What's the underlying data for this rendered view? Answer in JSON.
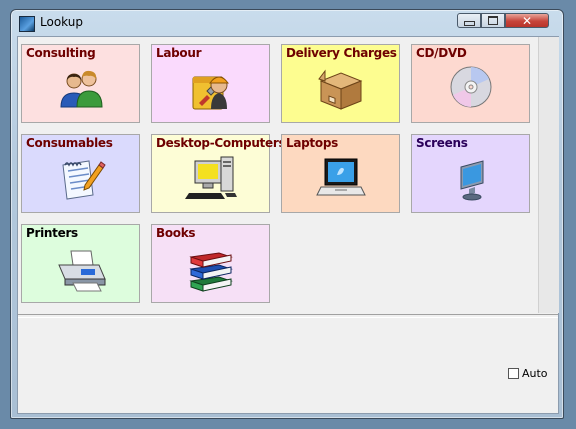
{
  "window": {
    "title": "Lookup"
  },
  "titlebar_buttons": {
    "minimize": "▭",
    "maximize": "□",
    "close": "✕"
  },
  "tiles": [
    {
      "label": "Consulting",
      "bg": "#fde0e0",
      "color": "#6e0000",
      "icon": "people-icon"
    },
    {
      "label": "Labour",
      "bg": "#fadafd",
      "color": "#6e0000",
      "icon": "worker-icon"
    },
    {
      "label": "Delivery Charges",
      "bg": "#fdfd90",
      "color": "#6e0000",
      "icon": "box-icon"
    },
    {
      "label": "CD/DVD",
      "bg": "#fdd9d0",
      "color": "#6e0000",
      "icon": "disc-icon"
    },
    {
      "label": "Consumables",
      "bg": "#dadafd",
      "color": "#6e0000",
      "icon": "notepad-icon"
    },
    {
      "label": "Desktop-Computers",
      "bg": "#fdfdd6",
      "color": "#6e0000",
      "icon": "desktop-computer-icon"
    },
    {
      "label": "Laptops",
      "bg": "#fdd9c0",
      "color": "#6e0000",
      "icon": "laptop-icon"
    },
    {
      "label": "Screens",
      "bg": "#e4d6fd",
      "color": "#2a005a",
      "icon": "monitor-icon"
    },
    {
      "label": "Printers",
      "bg": "#ddfddd",
      "color": "#000000",
      "icon": "printer-icon"
    },
    {
      "label": "Books",
      "bg": "#f6e0f6",
      "color": "#6e0000",
      "icon": "books-icon"
    }
  ],
  "auto": {
    "label": "Auto",
    "checked": false
  }
}
